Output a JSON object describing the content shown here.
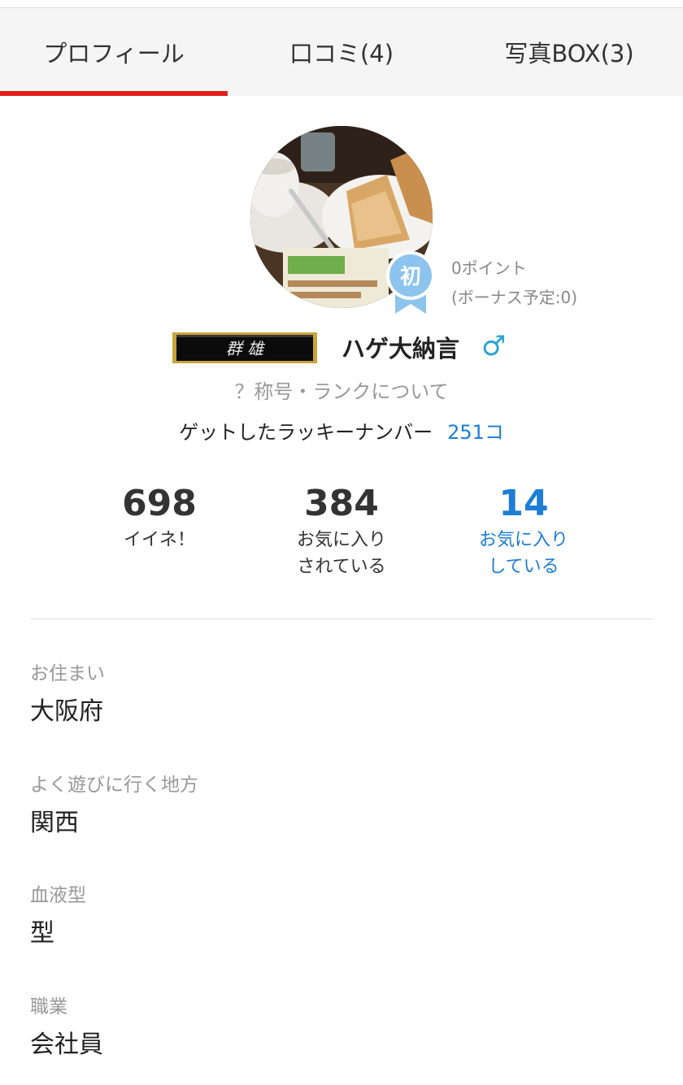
{
  "tabs": [
    {
      "label": "プロフィール",
      "active": true
    },
    {
      "label": "口コミ(4)",
      "active": false
    },
    {
      "label": "写真BOX(3)",
      "active": false
    }
  ],
  "profile": {
    "avatar_icon": "avatar-photo-coffee-sandwich",
    "badge_text": "初",
    "points": "0ポイント",
    "bonus": "(ボーナス予定:0)",
    "rank_plate_text": "群 雄",
    "name": "ハゲ大納言",
    "gender_symbol": "♂",
    "rank_link": "？称号・ランクについて",
    "lucky_label": "ゲットしたラッキーナンバー",
    "lucky_count": "251コ"
  },
  "stats": [
    {
      "value": "698",
      "label_line1": "イイネ！",
      "label_line2": ""
    },
    {
      "value": "384",
      "label_line1": "お気に入り",
      "label_line2": "されている"
    },
    {
      "value": "14",
      "label_line1": "お気に入り",
      "label_line2": "している"
    }
  ],
  "info": [
    {
      "key": "お住まい",
      "value": "大阪府"
    },
    {
      "key": "よく遊びに行く地方",
      "value": "関西"
    },
    {
      "key": "血液型",
      "value": "型"
    },
    {
      "key": "職業",
      "value": "会社員"
    }
  ],
  "colors": {
    "accent_red": "#e0201c",
    "link_blue": "#1c7ed6",
    "gender_blue": "#2aa4d8",
    "badge_blue": "#8cc4ee"
  }
}
